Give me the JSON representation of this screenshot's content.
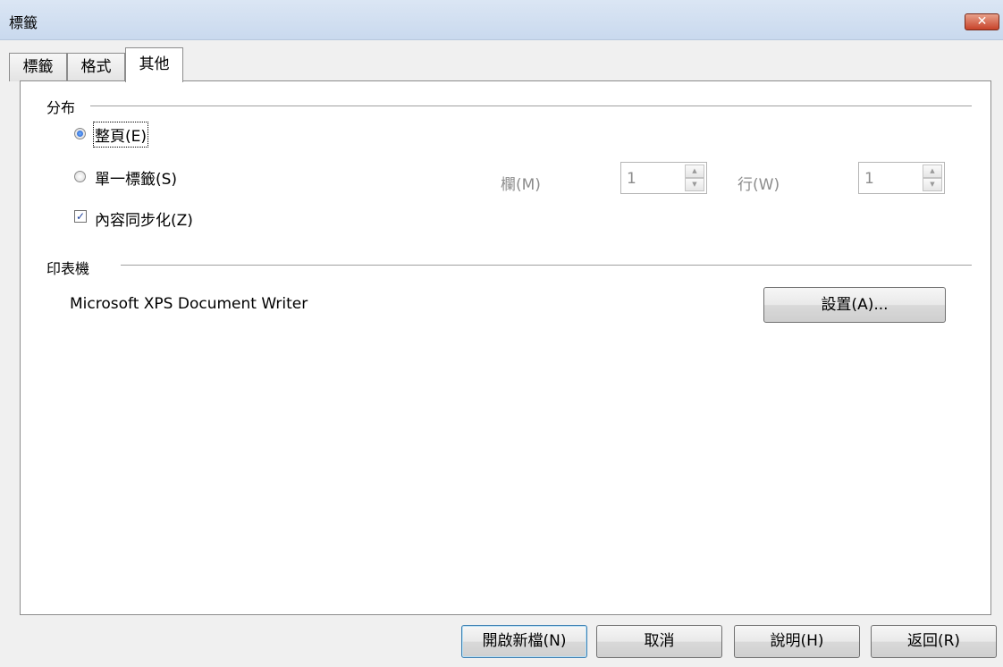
{
  "window": {
    "title": "標籤",
    "close_symbol": "✕"
  },
  "tabs": [
    {
      "label": "標籤"
    },
    {
      "label": "格式"
    },
    {
      "label": "其他",
      "active": true
    }
  ],
  "distribution": {
    "label": "分布",
    "whole_page": {
      "label": "整頁(E)",
      "checked": true
    },
    "single_label": {
      "label": "單一標籤(S)",
      "checked": false
    },
    "column": {
      "label": "欄(M)",
      "value": "1"
    },
    "row": {
      "label": "行(W)",
      "value": "1"
    },
    "sync_contents": {
      "label": "內容同步化(Z)",
      "checked": true,
      "mark": "✓"
    }
  },
  "printer": {
    "label": "印表機",
    "name": "Microsoft XPS Document Writer",
    "setup_label": "設置(A)..."
  },
  "footer": {
    "new_document": "開啟新檔(N)",
    "cancel": "取消",
    "help": "說明(H)",
    "reset": "返回(R)"
  },
  "spin_glyphs": {
    "up": "▲",
    "down": "▼"
  }
}
